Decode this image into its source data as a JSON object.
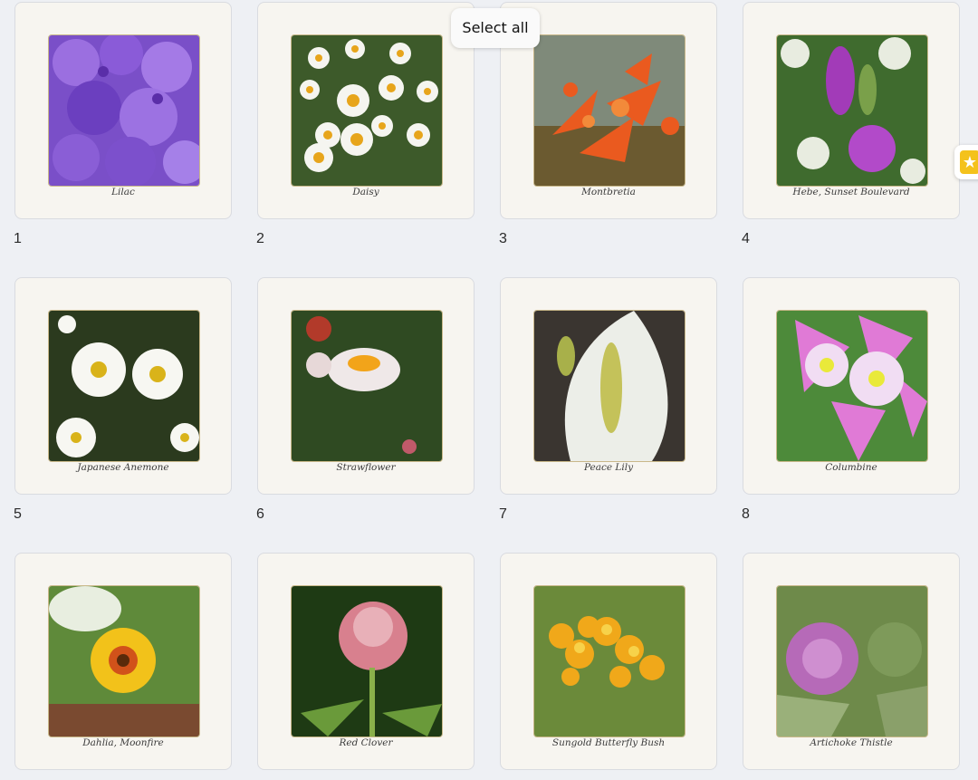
{
  "toolbar": {
    "select_all_label": "Select all"
  },
  "side_badge": {
    "icon": "star-icon",
    "glyph": "★",
    "color": "#f4c21c"
  },
  "pages": [
    {
      "number": "1",
      "caption": "Lilac"
    },
    {
      "number": "2",
      "caption": "Daisy"
    },
    {
      "number": "3",
      "caption": "Montbretia"
    },
    {
      "number": "4",
      "caption": "Hebe, Sunset Boulevard"
    },
    {
      "number": "5",
      "caption": "Japanese Anemone"
    },
    {
      "number": "6",
      "caption": "Strawflower"
    },
    {
      "number": "7",
      "caption": "Peace Lily"
    },
    {
      "number": "8",
      "caption": "Columbine"
    },
    {
      "number": "",
      "caption": "Dahlia, Moonfire"
    },
    {
      "number": "",
      "caption": "Red Clover"
    },
    {
      "number": "",
      "caption": "Sungold Butterfly Bush"
    },
    {
      "number": "",
      "caption": "Artichoke Thistle"
    }
  ]
}
